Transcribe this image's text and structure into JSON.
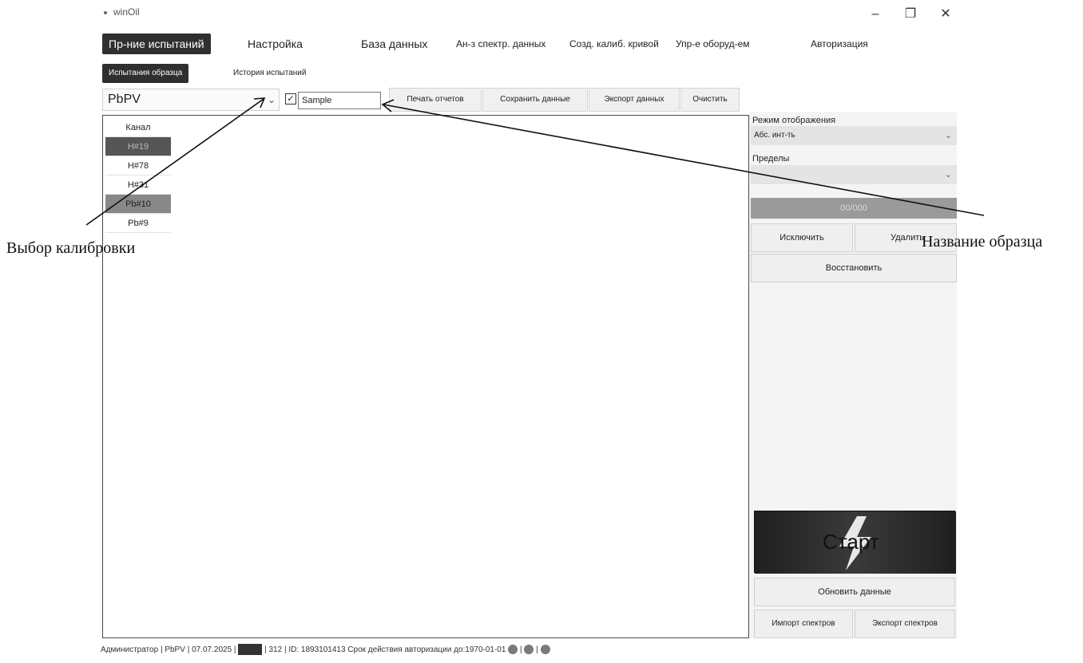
{
  "window": {
    "title": "winOil",
    "minimize_glyph": "–",
    "maximize_glyph": "❐",
    "close_glyph": "✕"
  },
  "menu": {
    "items": [
      {
        "label": "Пр-ние испытаний",
        "active": true
      },
      {
        "label": "Настройка"
      },
      {
        "label": "База данных"
      },
      {
        "label": "Ан-з спектр. данных"
      },
      {
        "label": "Созд. калиб. кривой"
      },
      {
        "label": "Упр-е оборуд-ем"
      },
      {
        "label": "Авторизация"
      }
    ],
    "sub_items": [
      {
        "label": "Испытания образца",
        "active": true
      },
      {
        "label": "История испытаний"
      }
    ]
  },
  "toolbar": {
    "calibration_value": "PbPV",
    "sample_checked": true,
    "sample_name": "Sample",
    "buttons": [
      "Печать отчетов",
      "Сохранить данные",
      "Экспорт данных",
      "Очистить"
    ]
  },
  "channels": {
    "header": "Канал",
    "items": [
      "H#19",
      "H#78",
      "H#31",
      "Pb#10",
      "Pb#9"
    ]
  },
  "right_panel": {
    "display_mode_label": "Режим отображения",
    "display_mode_value": "Абс. инт-ть",
    "limits_label": "Пределы",
    "limits_value": "",
    "progress_text": "00/000",
    "exclude_label": "Исключить",
    "delete_label": "Удалить",
    "restore_label": "Восстановить",
    "start_label": "Старт",
    "refresh_label": "Обновить данные",
    "import_label": "Импорт спектров",
    "export_label": "Экспорт спектров"
  },
  "status": {
    "user": "Администратор",
    "calibration": "PbPV",
    "date": "07.07.2025",
    "count": "312",
    "id": "ID: 1893101413",
    "auth_expiry": "Срок действия авторизации до:1970-01-01",
    "separator": "|"
  },
  "annotations": {
    "calibration_choice": "Выбор калибровки",
    "sample_name": "Название образца"
  }
}
